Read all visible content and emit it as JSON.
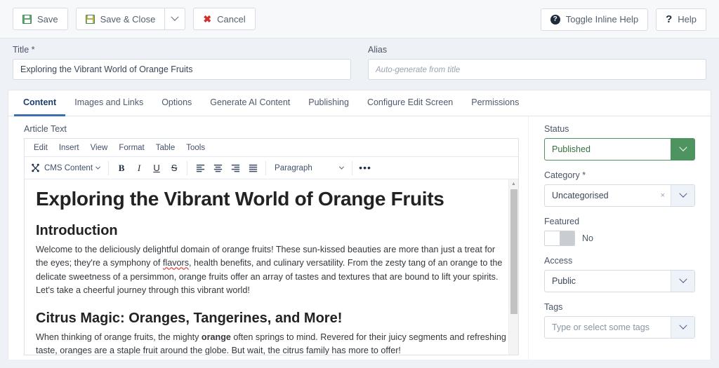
{
  "toolbar": {
    "save_label": "Save",
    "save_close_label": "Save & Close",
    "save_dropdown_icon": "chevron-down-icon",
    "cancel_label": "Cancel",
    "toggle_inline_help_label": "Toggle Inline Help",
    "help_label": "Help"
  },
  "meta": {
    "title_label": "Title *",
    "title_value": "Exploring the Vibrant World of Orange Fruits",
    "alias_label": "Alias",
    "alias_value": "",
    "alias_placeholder": "Auto-generate from title"
  },
  "tabs": [
    {
      "label": "Content",
      "active": true
    },
    {
      "label": "Images and Links",
      "active": false
    },
    {
      "label": "Options",
      "active": false
    },
    {
      "label": "Generate AI Content",
      "active": false
    },
    {
      "label": "Publishing",
      "active": false
    },
    {
      "label": "Configure Edit Screen",
      "active": false
    },
    {
      "label": "Permissions",
      "active": false
    }
  ],
  "editor": {
    "section_label": "Article Text",
    "menubar": [
      "Edit",
      "Insert",
      "View",
      "Format",
      "Table",
      "Tools"
    ],
    "cms_button_label": "CMS Content",
    "bold_label": "B",
    "italic_label": "I",
    "underline_label": "U",
    "strikethrough_label": "S",
    "block_format": "Paragraph",
    "more_label": "•••",
    "content": {
      "h1": "Exploring the Vibrant World of Orange Fruits",
      "h2_intro": "Introduction",
      "p_intro_1": "Welcome to the deliciously delightful domain of orange fruits! These sun-kissed beauties are more than just a treat for the eyes; they're a symphony of ",
      "p_intro_misspelled": "flavors",
      "p_intro_2": ", health benefits, and culinary versatility. From the zesty tang of an orange to the delicate sweetness of a persimmon, orange fruits offer an array of tastes and textures that are bound to lift your spirits. Let's take a cheerful journey through this vibrant world!",
      "h2_citrus": "Citrus Magic: Oranges, Tangerines, and More!",
      "p_citrus_1": "When thinking of orange fruits, the mighty ",
      "p_citrus_bold": "orange",
      "p_citrus_2": " often springs to mind. Revered for their juicy segments and refreshing taste, oranges are a staple fruit around the globe. But wait, the citrus family has more to offer!"
    }
  },
  "sidebar": {
    "status_label": "Status",
    "status_value": "Published",
    "category_label": "Category *",
    "category_value": "Uncategorised",
    "category_clear": "×",
    "featured_label": "Featured",
    "featured_value": "No",
    "access_label": "Access",
    "access_value": "Public",
    "tags_label": "Tags",
    "tags_placeholder": "Type or select some tags"
  },
  "colors": {
    "accent_blue": "#3e6eb0",
    "published_green": "#4e9460",
    "cancel_red": "#d0302f",
    "page_bg": "#eef1f6"
  }
}
